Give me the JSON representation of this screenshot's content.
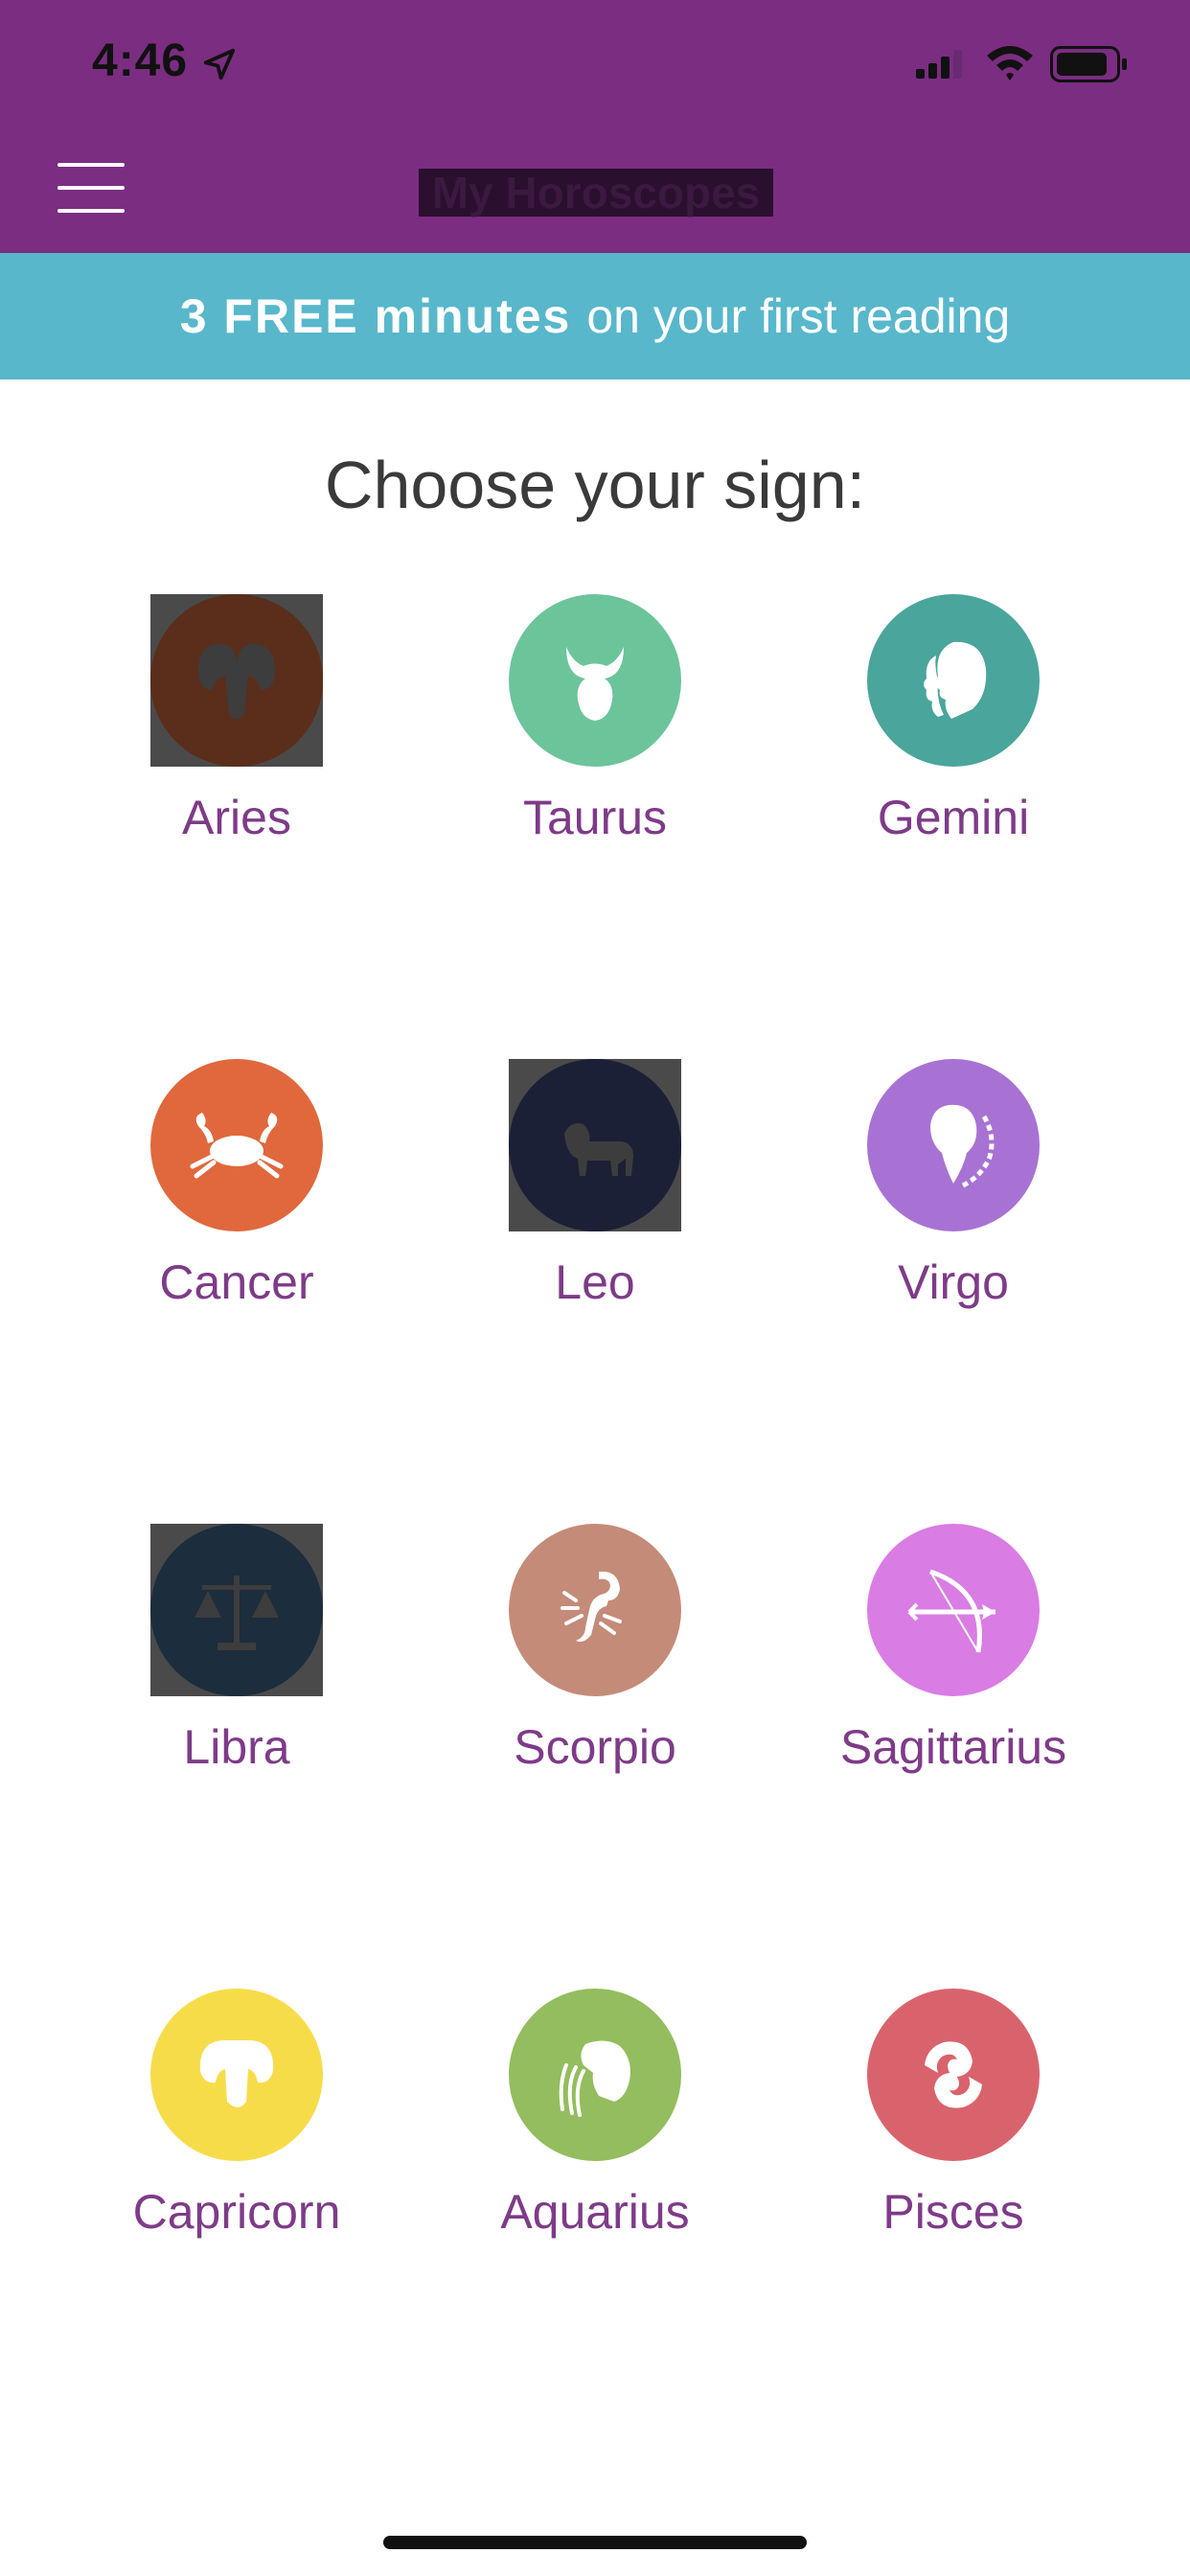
{
  "status_bar": {
    "time": "4:46",
    "icons": [
      "location-arrow-icon",
      "cellular-signal-icon",
      "wifi-icon",
      "battery-icon"
    ]
  },
  "nav": {
    "menu_icon": "hamburger-menu-icon",
    "title": "My Horoscopes"
  },
  "promo": {
    "bold": "3 FREE minutes",
    "text": "on your first reading",
    "color": "#58b7cb"
  },
  "heading": "Choose your sign:",
  "signs": [
    {
      "label": "Aries",
      "color": "#5a2e1a",
      "icon": "ram-icon"
    },
    {
      "label": "Taurus",
      "color": "#6cc49a",
      "icon": "bull-icon"
    },
    {
      "label": "Gemini",
      "color": "#4aa59c",
      "icon": "twins-icon"
    },
    {
      "label": "Cancer",
      "color": "#e0683c",
      "icon": "crab-icon"
    },
    {
      "label": "Leo",
      "color": "#1b2036",
      "icon": "lion-icon"
    },
    {
      "label": "Virgo",
      "color": "#a872d4",
      "icon": "maiden-icon"
    },
    {
      "label": "Libra",
      "color": "#1c2d3d",
      "icon": "scales-icon"
    },
    {
      "label": "Scorpio",
      "color": "#c48b79",
      "icon": "scorpion-icon"
    },
    {
      "label": "Sagittarius",
      "color": "#d97ce4",
      "icon": "bow-arrow-icon"
    },
    {
      "label": "Capricorn",
      "color": "#f7dc4a",
      "icon": "goat-icon"
    },
    {
      "label": "Aquarius",
      "color": "#93bd5e",
      "icon": "water-bearer-icon"
    },
    {
      "label": "Pisces",
      "color": "#d9636c",
      "icon": "fish-icon"
    }
  ],
  "theme": {
    "primary": "#7b2d82",
    "label_color": "#7e3b88"
  }
}
